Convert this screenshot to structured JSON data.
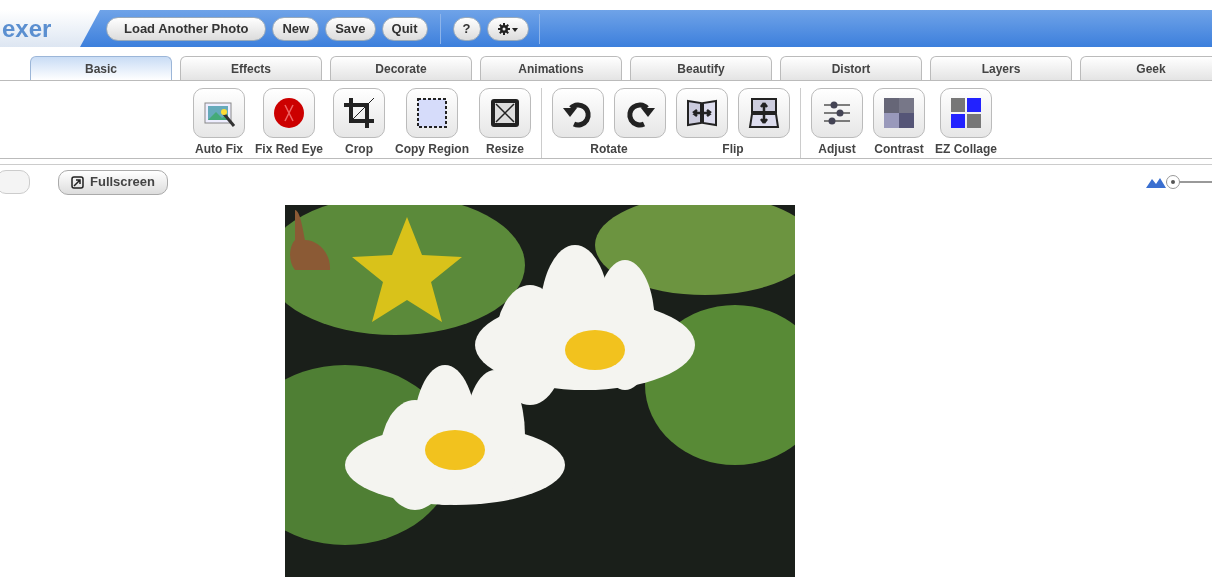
{
  "logo": {
    "text": "exer"
  },
  "top_buttons": [
    {
      "label": "Load Another Photo",
      "kind": "text"
    },
    {
      "label": "New",
      "kind": "text"
    },
    {
      "label": "Save",
      "kind": "text"
    },
    {
      "label": "Quit",
      "kind": "text"
    },
    {
      "label": "?",
      "kind": "text"
    },
    {
      "kind": "gear"
    }
  ],
  "tabs": [
    {
      "label": "Basic",
      "selected": true
    },
    {
      "label": "Effects",
      "selected": false
    },
    {
      "label": "Decorate",
      "selected": false
    },
    {
      "label": "Animations",
      "selected": false
    },
    {
      "label": "Beautify",
      "selected": false
    },
    {
      "label": "Distort",
      "selected": false
    },
    {
      "label": "Layers",
      "selected": false
    },
    {
      "label": "Geek",
      "selected": false
    }
  ],
  "tool_sections": [
    {
      "groups": [
        {
          "label": "Auto Fix",
          "kind": "single"
        },
        {
          "label": "Fix Red Eye",
          "kind": "single"
        },
        {
          "label": "Crop",
          "kind": "single"
        },
        {
          "label": "Copy Region",
          "kind": "single"
        },
        {
          "label": "Resize",
          "kind": "single"
        }
      ]
    },
    {
      "groups": [
        {
          "label": "Rotate",
          "kind": "pair"
        },
        {
          "label": "Flip",
          "kind": "pair"
        }
      ]
    },
    {
      "groups": [
        {
          "label": "Adjust",
          "kind": "single"
        },
        {
          "label": "Contrast",
          "kind": "single"
        },
        {
          "label": "EZ Collage",
          "kind": "single"
        }
      ]
    }
  ],
  "view_bar": {
    "fullscreen": "Fullscreen",
    "zoom": {
      "level": 0.05
    }
  }
}
